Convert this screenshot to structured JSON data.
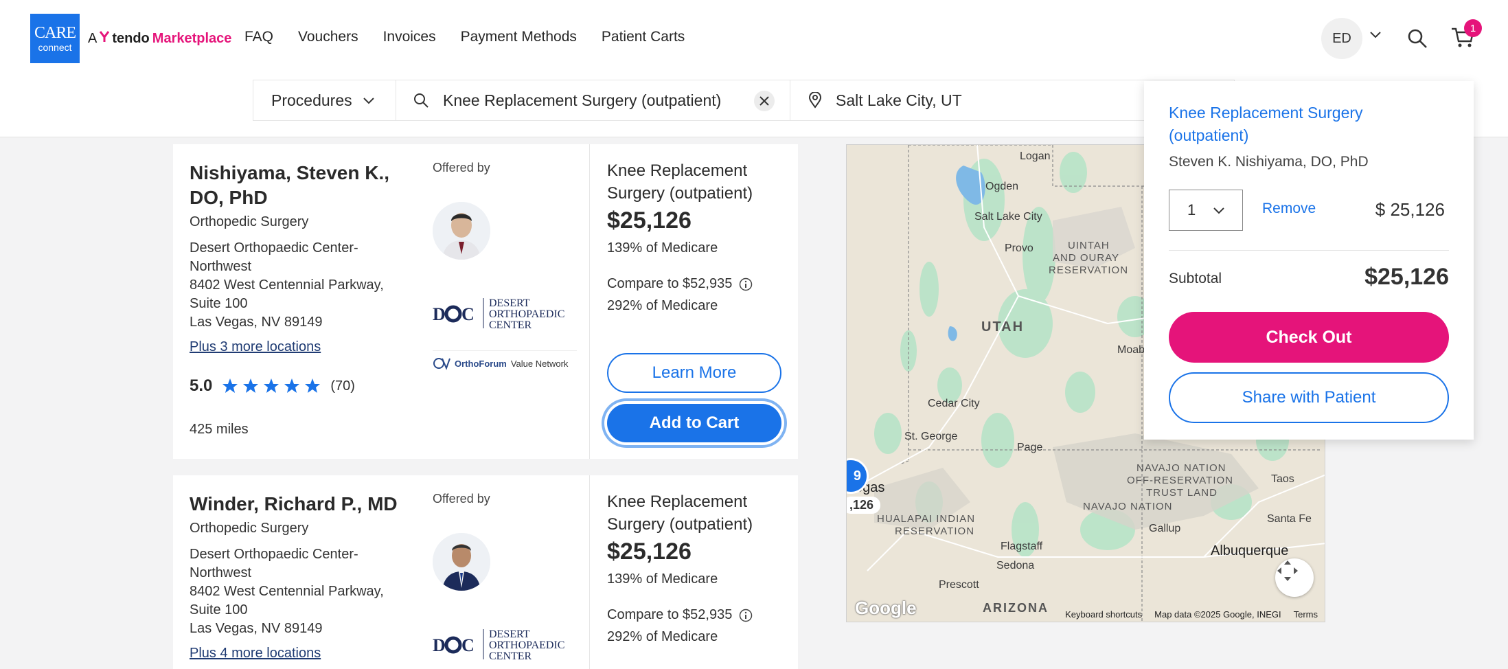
{
  "brand": {
    "logo_line1": "CARE",
    "logo_line2": "connect",
    "tag_a": "A",
    "tag_tendo": "tendo",
    "tag_marketplace": "Marketplace"
  },
  "nav": {
    "faq": "FAQ",
    "vouchers": "Vouchers",
    "invoices": "Invoices",
    "payment_methods": "Payment Methods",
    "patient_carts": "Patient Carts"
  },
  "user": {
    "initials": "ED"
  },
  "cart": {
    "count": "1"
  },
  "search": {
    "category": "Procedures",
    "query": "Knee Replacement Surgery (outpatient)",
    "location": "Salt Lake City, UT"
  },
  "providers": [
    {
      "name": "Nishiyama, Steven K., DO, PhD",
      "specialty": "Orthopedic Surgery",
      "facility": "Desert Orthopaedic Center-Northwest",
      "address1": "8402 West Centennial Parkway, Suite 100",
      "address2": "Las Vegas, NV 89149",
      "more_locations": "Plus 3 more locations",
      "rating": "5.0",
      "review_count": "(70)",
      "distance": "425 miles",
      "offered_by": "Offered by",
      "network": "Value Network",
      "network_brand": "OrthoForum",
      "procedure": "Knee Replacement Surgery (outpatient)",
      "price": "$25,126",
      "medicare_pct": "139% of Medicare",
      "compare": "Compare to $52,935",
      "compare_pct": "292% of Medicare",
      "learn_more": "Learn More",
      "add_to_cart": "Add to Cart"
    },
    {
      "name": "Winder, Richard P., MD",
      "specialty": "Orthopedic Surgery",
      "facility": "Desert Orthopaedic Center-Northwest",
      "address1": "8402 West Centennial Parkway, Suite 100",
      "address2": "Las Vegas, NV 89149",
      "more_locations": "Plus 4 more locations",
      "offered_by": "Offered by",
      "procedure": "Knee Replacement Surgery (outpatient)",
      "price": "$25,126",
      "medicare_pct": "139% of Medicare",
      "compare": "Compare to $52,935",
      "compare_pct": "292% of Medicare"
    }
  ],
  "doc_logo": {
    "abbr": "D C",
    "line1": "DESERT",
    "line2": "ORTHOPAEDIC",
    "line3": "CENTER"
  },
  "map": {
    "labels": {
      "logan": "Logan",
      "ogden": "Ogden",
      "slc": "Salt Lake City",
      "provo": "Provo",
      "uintah": "UINTAH",
      "and_ouray": "AND OURAY",
      "reservation": "RESERVATION",
      "utah": "UTAH",
      "moab": "Moab",
      "cedar": "Cedar City",
      "stgeorge": "St. George",
      "page": "Page",
      "vegas": "egas",
      "hualapai1": "HUALAPAI INDIAN",
      "hualapai2": "RESERVATION",
      "navajo_offres1": "NAVAJO NATION",
      "navajo_offres2": "OFF-RESERVATION",
      "navajo_offres3": "TRUST LAND",
      "navajo": "NAVAJO NATION",
      "taos": "Taos",
      "gallup": "Gallup",
      "santafe": "Santa Fe",
      "flagstaff": "Flagstaff",
      "sedona": "Sedona",
      "albuquerque": "Albuquerque",
      "prescott": "Prescott",
      "arizona": "ARIZONA"
    },
    "pin_count": "9",
    "pin_price": ",126",
    "google": "Google",
    "keyboard": "Keyboard shortcuts",
    "mapdata": "Map data ©2025 Google, INEGI",
    "terms": "Terms"
  },
  "cart_popup": {
    "item_title": "Knee Replacement Surgery (outpatient)",
    "item_doctor": "Steven K. Nishiyama, DO, PhD",
    "qty": "1",
    "remove": "Remove",
    "item_price": "$ 25,126",
    "subtotal_label": "Subtotal",
    "subtotal": "$25,126",
    "checkout": "Check Out",
    "share": "Share with Patient"
  },
  "colors": {
    "primary": "#1a73e8",
    "accent": "#e5147a",
    "star": "#1a73e8"
  }
}
